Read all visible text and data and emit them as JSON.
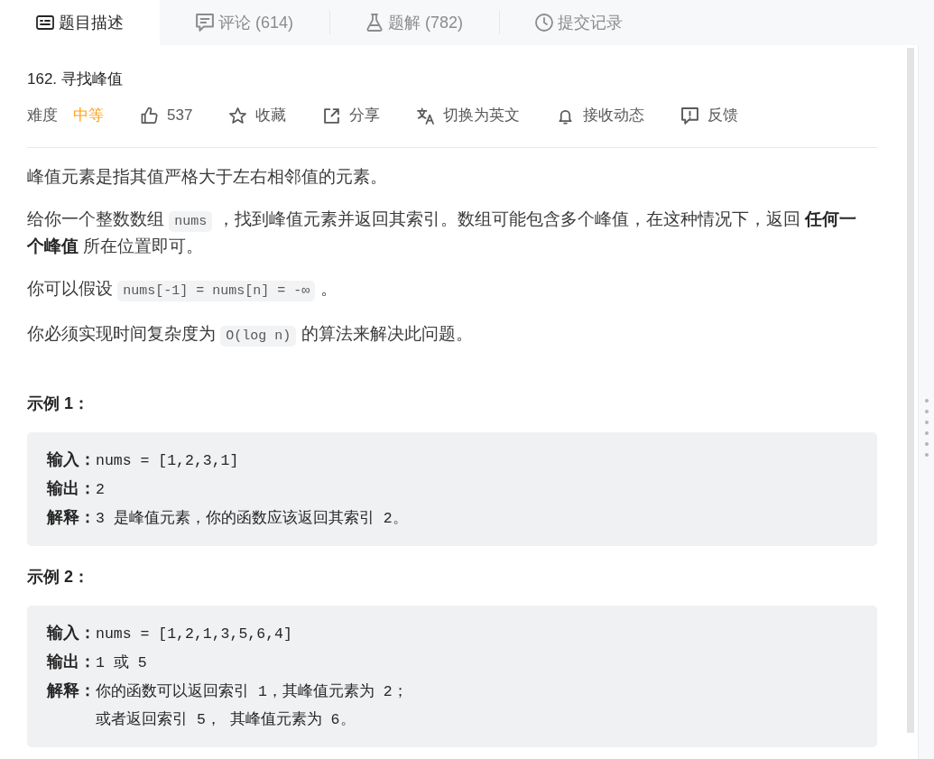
{
  "tabs": [
    {
      "kind": "description",
      "label": "题目描述",
      "selected": true
    },
    {
      "kind": "comments",
      "label": "评论 (614)",
      "selected": false
    },
    {
      "kind": "solutions",
      "label": "题解 (782)",
      "selected": false
    },
    {
      "kind": "submissions",
      "label": "提交记录",
      "selected": false
    }
  ],
  "problem": {
    "title": "162. 寻找峰值",
    "difficulty_label": "难度",
    "difficulty": "中等",
    "actions": [
      {
        "kind": "like",
        "label": "537"
      },
      {
        "kind": "favorite",
        "label": "收藏"
      },
      {
        "kind": "share",
        "label": "分享"
      },
      {
        "kind": "translate",
        "label": "切换为英文"
      },
      {
        "kind": "subscribe",
        "label": "接收动态"
      },
      {
        "kind": "feedback",
        "label": "反馈"
      }
    ]
  },
  "description": [
    {
      "segments": [
        {
          "kind": "text",
          "text": "峰值元素是指其值严格大于左右相邻值的元素。"
        }
      ]
    },
    {
      "segments": [
        {
          "kind": "text",
          "text": "给你一个整数数组 "
        },
        {
          "kind": "code",
          "text": "nums"
        },
        {
          "kind": "text",
          "text": " ，找到峰值元素并返回其索引。数组可能包含多个峰值，在这种情况下，返回 **任何一个峰值** 所在位置即可。"
        }
      ]
    },
    {
      "segments": [
        {
          "kind": "text",
          "text": "你可以假设 "
        },
        {
          "kind": "code",
          "text": "nums[-1] = nums[n] = -∞"
        },
        {
          "kind": "text",
          "text": " 。"
        }
      ]
    },
    {
      "segments": [
        {
          "kind": "text",
          "text": "你必须实现时间复杂度为 "
        },
        {
          "kind": "code",
          "text": "O(log n)"
        },
        {
          "kind": "text",
          "text": " 的算法来解决此问题。"
        }
      ]
    }
  ],
  "examples": [
    {
      "heading": "示例 1：",
      "lines": [
        {
          "label": "输入：",
          "text": "nums = [1,2,3,1]"
        },
        {
          "label": "输出：",
          "text": "2"
        },
        {
          "label": "解释：",
          "text": "3 是峰值元素，你的函数应该返回其索引 2。"
        }
      ]
    },
    {
      "heading": "示例 2：",
      "lines": [
        {
          "label": "输入：",
          "text": "nums = [1,2,1,3,5,6,4]"
        },
        {
          "label": "输出：",
          "text": "1 或 5"
        },
        {
          "label": "解释：",
          "text": "你的函数可以返回索引 1，其峰值元素为 2；"
        },
        {
          "text": "或者返回索引 5， 其峰值元素为 6。"
        }
      ]
    }
  ]
}
